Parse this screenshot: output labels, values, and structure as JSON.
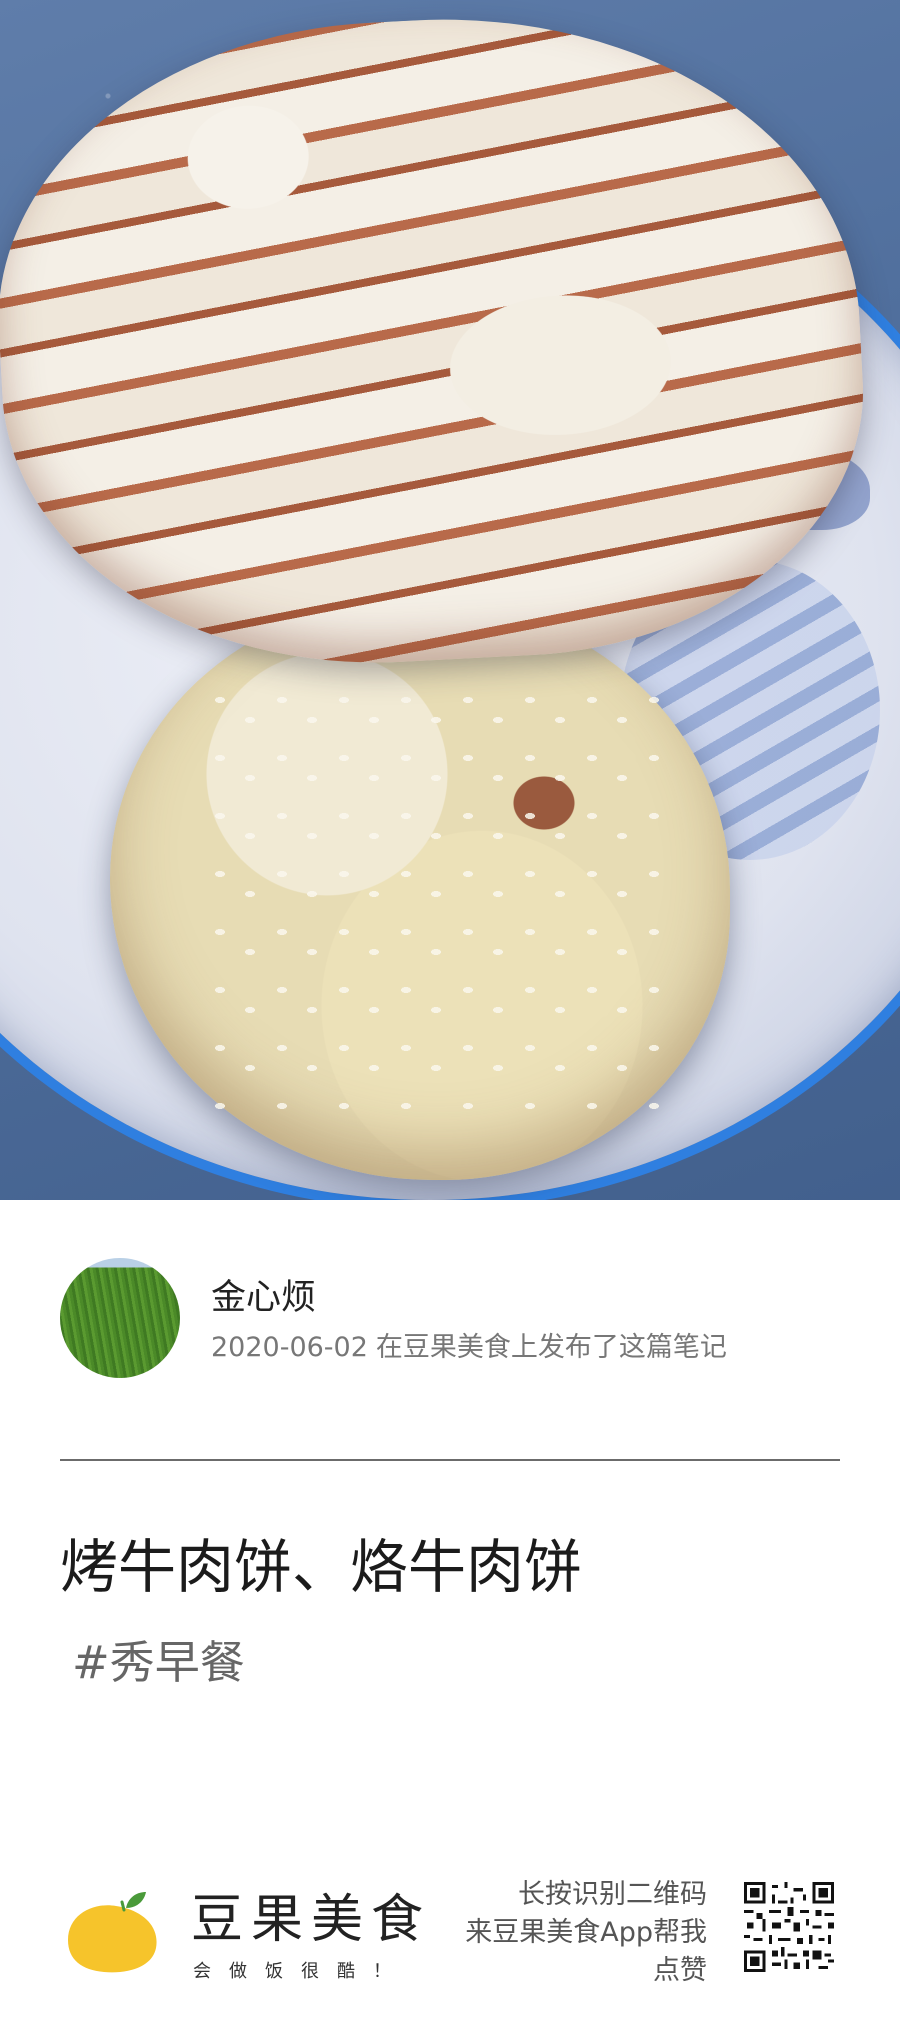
{
  "author": {
    "name": "金心烦",
    "date": "2020-06-02",
    "published_text": "在豆果美食上发布了这篇笔记"
  },
  "note": {
    "title": "烤牛肉饼、烙牛肉饼",
    "tag": "#秀早餐"
  },
  "footer": {
    "brand": "豆果美食",
    "slogan": "会做饭很酷！",
    "hint_lines": [
      "长按识别二维码",
      "来豆果美食App帮我",
      "点赞"
    ]
  },
  "colors": {
    "brand_yellow": "#f6c42b",
    "brand_leaf": "#4a9a3a",
    "plate_rim": "#2f7fe0"
  },
  "icons": {
    "logo": "mango-logo",
    "qr": "qr-code"
  }
}
